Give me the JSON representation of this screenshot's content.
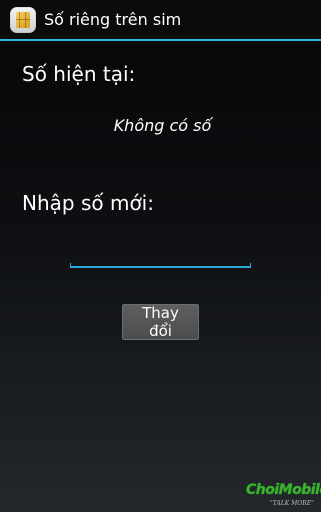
{
  "action_bar": {
    "title": "Số riêng trên sim",
    "icon": "sim-card-icon"
  },
  "current_section": {
    "label": "Số hiện tại:",
    "value": "Không có số"
  },
  "new_section": {
    "label": "Nhập số mới:",
    "input_value": "",
    "input_placeholder": ""
  },
  "change_button": {
    "label": "Thay đổi"
  },
  "watermark": {
    "brand": "ChoiMobile",
    "tagline": "\"TALK MORE\""
  },
  "colors": {
    "accent": "#33b5e5",
    "button": "#555759"
  }
}
